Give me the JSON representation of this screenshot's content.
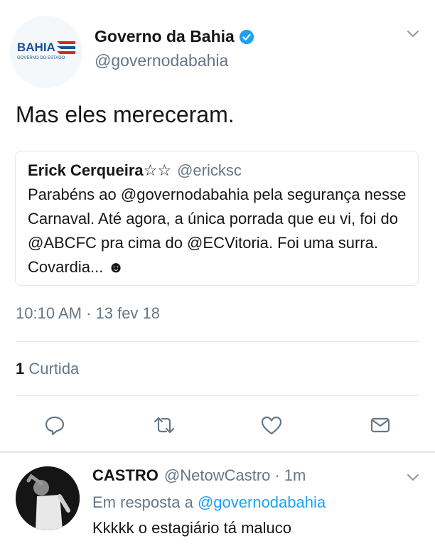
{
  "tweet": {
    "author_name": "Governo da Bahia",
    "author_handle": "@governodabahia",
    "avatar_logo_text": "BAHIA",
    "avatar_logo_subtext": "GOVERNO DO ESTADO",
    "verified": true,
    "text": "Mas eles mereceram.",
    "timestamp": "10:10 AM · 13 fev 18",
    "likes_count": "1",
    "likes_label": "Curtida"
  },
  "quoted": {
    "author_name": "Erick Cerqueira☆☆",
    "author_handle": "@ericksc",
    "text": "Parabéns ao @governodabahia pela segurança nesse Carnaval. Até agora, a única porrada que eu vi, foi do @ABCFC pra cima do @ECVitoria. Foi uma surra. Covardia... ☻"
  },
  "actions": {
    "icons": [
      "reply-icon",
      "retweet-icon",
      "like-icon",
      "dm-icon"
    ]
  },
  "reply": {
    "author_name": "CASTRO",
    "author_handle": "@NetowCastro",
    "time": "1m",
    "meta_sep": "·",
    "in_reply_prefix": "Em resposta a",
    "in_reply_to": "@governodabahia",
    "text": "Kkkkk o estagiário tá maluco"
  },
  "colors": {
    "accent": "#1da1f2",
    "secondary_text": "#657786",
    "border": "#e1e8ed",
    "logo_blue": "#1b4f9c",
    "logo_red": "#d52b1e"
  }
}
